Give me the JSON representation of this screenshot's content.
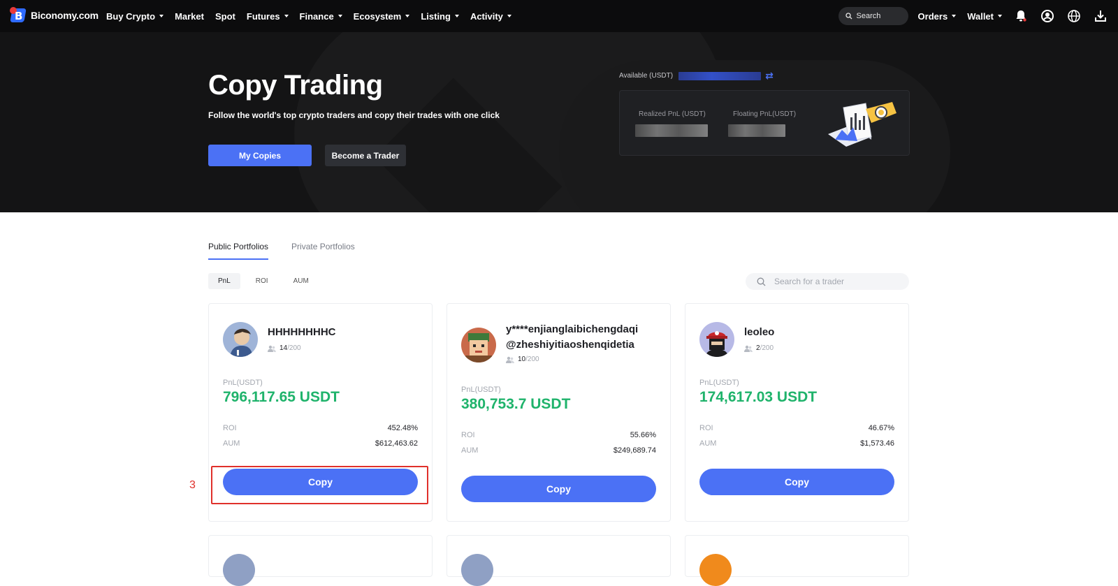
{
  "nav": {
    "logo_text": "Biconomy.com",
    "menu": [
      {
        "label": "Buy Crypto",
        "dropdown": true
      },
      {
        "label": "Market",
        "dropdown": false
      },
      {
        "label": "Spot",
        "dropdown": false
      },
      {
        "label": "Futures",
        "dropdown": true
      },
      {
        "label": "Finance",
        "dropdown": true
      },
      {
        "label": "Ecosystem",
        "dropdown": true
      },
      {
        "label": "Listing",
        "dropdown": true
      },
      {
        "label": "Activity",
        "dropdown": true
      }
    ],
    "search_label": "Search",
    "orders_label": "Orders",
    "wallet_label": "Wallet",
    "icons": [
      "bell-icon",
      "user-icon",
      "globe-icon",
      "download-icon"
    ]
  },
  "hero": {
    "title": "Copy Trading",
    "subtitle": "Follow the world's top crypto traders and copy their trades with one click",
    "my_copies_label": "My Copies",
    "become_trader_label": "Become a Trader",
    "available_label": "Available (USDT)",
    "realized_pnl_label": "Realized PnL (USDT)",
    "floating_pnl_label": "Floating PnL(USDT)"
  },
  "tabs": [
    {
      "label": "Public Portfolios",
      "active": true
    },
    {
      "label": "Private Portfolios",
      "active": false
    }
  ],
  "filters": [
    {
      "label": "PnL",
      "active": true
    },
    {
      "label": "ROI",
      "active": false
    },
    {
      "label": "AUM",
      "active": false
    }
  ],
  "trader_search_placeholder": "Search for a trader",
  "cards": [
    {
      "name": "HHHHHHHHC",
      "followers": "14",
      "max": "/200",
      "pnl_label": "PnL(USDT)",
      "pnl": "796,117.65 USDT",
      "roi_label": "ROI",
      "roi": "452.48%",
      "aum_label": "AUM",
      "aum": "$612,463.62",
      "copy_label": "Copy"
    },
    {
      "name": "y****enjianglaibichengdaqi@zheshiyitiaoshenqidetia",
      "name_line1": "y****enjianglaibichengdaqi",
      "name_line2": "@zheshiyitiaoshenqidetia",
      "followers": "10",
      "max": "/200",
      "pnl_label": "PnL(USDT)",
      "pnl": "380,753.7 USDT",
      "roi_label": "ROI",
      "roi": "55.66%",
      "aum_label": "AUM",
      "aum": "$249,689.74",
      "copy_label": "Copy"
    },
    {
      "name": "leoleo",
      "followers": "2",
      "max": "/200",
      "pnl_label": "PnL(USDT)",
      "pnl": "174,617.03 USDT",
      "roi_label": "ROI",
      "roi": "46.67%",
      "aum_label": "AUM",
      "aum": "$1,573.46",
      "copy_label": "Copy"
    }
  ],
  "annotation": {
    "number": "3"
  },
  "colors": {
    "accent": "#4b71f5",
    "positive": "#1fb36b",
    "annotation": "#e0302b",
    "nav_bg": "#0c0c0d"
  }
}
